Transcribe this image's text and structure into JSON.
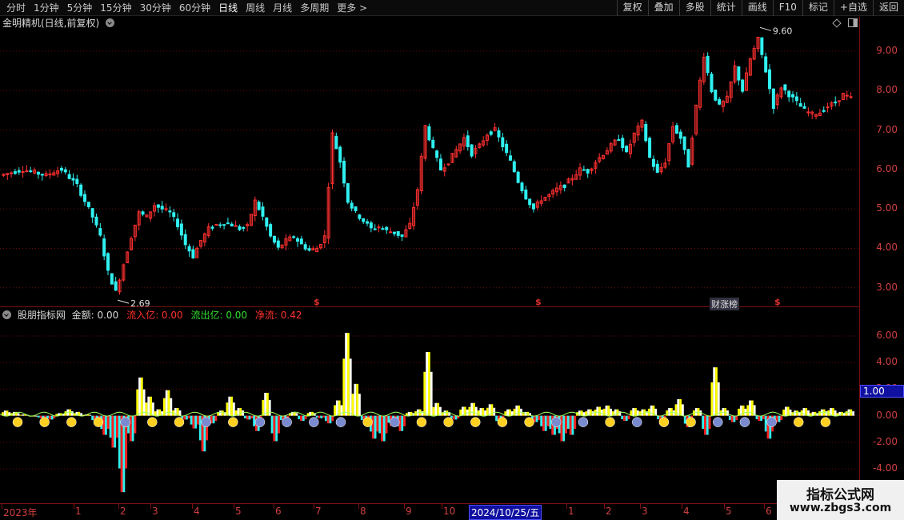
{
  "toolbar": {
    "periods": [
      "分时",
      "1分钟",
      "5分钟",
      "15分钟",
      "30分钟",
      "60分钟",
      "日线",
      "周线",
      "月线",
      "多周期",
      "更多 >"
    ],
    "active_period": "日线",
    "buttons": [
      "复权",
      "叠加",
      "多股",
      "统计",
      "画线",
      "F10",
      "标记",
      "+自选",
      "返回"
    ]
  },
  "main_pane": {
    "title": "金明精机(日线,前复权)",
    "high_label": "9.60",
    "low_label": "2.69",
    "marker_symbol": "$",
    "rank_badge": "财涨榜"
  },
  "indicator_pane": {
    "name": "股朋指标网",
    "amount_label": "金额: 0.00",
    "inflow_label": "流入亿: 0.00",
    "outflow_label": "流出亿: 0.00",
    "net_label": "净流: 0.42",
    "cursor_value": "1.00"
  },
  "date_axis": {
    "labels": [
      "2023年",
      "1",
      "2",
      "3",
      "4",
      "5",
      "6",
      "7",
      "8",
      "9",
      "10",
      "1",
      "2",
      "3",
      "4",
      "5",
      "6"
    ],
    "cursor_date": "2024/10/25/五"
  },
  "watermark": {
    "title": "指标公式网",
    "url": "www.zbgs3.com"
  },
  "colors": {
    "up": "#ff3030",
    "down": "#30f0f0",
    "inflow": "#ffffff",
    "inflow2": "#ffff00",
    "outflow": "#30f0f0",
    "outflow2": "#ff2020",
    "grid": "#6a0d0d",
    "axis_text": "#d04040"
  },
  "chart_data": [
    {
      "type": "candlestick",
      "title": "金明精机(日线,前复权)",
      "y_ticks": [
        3.0,
        4.0,
        5.0,
        6.0,
        7.0,
        8.0,
        9.0
      ],
      "ylim": [
        2.55,
        9.85
      ],
      "grid": true,
      "annotations": [
        {
          "label": "9.60",
          "value": 9.6
        },
        {
          "label": "2.69",
          "value": 2.69
        }
      ],
      "close_path": [
        5.85,
        5.9,
        5.95,
        6.0,
        5.95,
        5.9,
        5.85,
        5.95,
        6.0,
        5.8,
        5.6,
        5.2,
        4.8,
        4.3,
        3.4,
        2.9,
        3.6,
        4.3,
        4.9,
        4.8,
        5.1,
        5.0,
        4.9,
        4.6,
        4.1,
        3.8,
        4.2,
        4.5,
        4.6,
        4.65,
        4.6,
        4.5,
        4.55,
        5.2,
        4.8,
        4.3,
        4.0,
        4.2,
        4.3,
        4.1,
        3.95,
        4.0,
        4.3,
        6.9,
        6.2,
        5.2,
        4.9,
        4.7,
        4.5,
        4.55,
        4.45,
        4.4,
        4.3,
        4.6,
        5.5,
        7.1,
        6.5,
        6.0,
        6.2,
        6.5,
        6.8,
        6.4,
        6.6,
        6.9,
        7.0,
        6.6,
        6.2,
        5.7,
        5.3,
        5.0,
        5.25,
        5.35,
        5.5,
        5.6,
        5.8,
        6.0,
        5.95,
        6.2,
        6.4,
        6.6,
        6.8,
        6.4,
        6.9,
        7.2,
        6.3,
        5.9,
        6.2,
        7.1,
        6.8,
        6.1,
        7.6,
        8.9,
        8.0,
        7.6,
        7.8,
        8.6,
        8.0,
        8.8,
        9.3,
        8.5,
        7.6,
        8.1,
        7.9,
        7.7,
        7.5,
        7.4,
        7.45,
        7.6,
        7.7,
        7.9,
        7.8
      ]
    },
    {
      "type": "bar",
      "name": "股朋指标网",
      "y_ticks": [
        -4.0,
        -2.0,
        0.0,
        2.0,
        4.0,
        6.0
      ],
      "ylim": [
        -6.4,
        7.2
      ],
      "grid": true,
      "series_labels": [
        "金额",
        "流入亿",
        "流出亿",
        "净流"
      ],
      "values": [
        0.4,
        0.3,
        0.1,
        0.0,
        -0.2,
        -0.3,
        0.2,
        0.5,
        0.3,
        0.1,
        -0.5,
        -1.5,
        -2.5,
        -6.0,
        -2.0,
        3.0,
        1.5,
        0.5,
        2.0,
        0.6,
        -0.3,
        -1.0,
        -2.8,
        -0.6,
        0.4,
        1.5,
        0.6,
        -0.3,
        -1.2,
        1.8,
        -2.0,
        -0.5,
        0.3,
        -0.4,
        0.3,
        -0.2,
        -0.6,
        1.2,
        6.5,
        2.5,
        -0.5,
        -1.8,
        -2.0,
        -0.8,
        -1.2,
        0.3,
        0.5,
        5.0,
        1.0,
        0.4,
        -0.3,
        0.7,
        1.0,
        0.6,
        0.9,
        -0.6,
        0.5,
        0.8,
        0.3,
        -0.5,
        -1.2,
        -1.5,
        -2.0,
        -1.5,
        0.4,
        0.5,
        0.7,
        0.8,
        0.5,
        -0.4,
        0.6,
        0.5,
        0.8,
        -0.4,
        0.6,
        1.3,
        -0.9,
        0.6,
        -1.5,
        3.8,
        0.6,
        -0.5,
        0.8,
        1.2,
        -0.4,
        -1.8,
        -0.5,
        0.7,
        0.4,
        0.6,
        0.3,
        0.5,
        0.6,
        0.3,
        0.5
      ]
    }
  ]
}
